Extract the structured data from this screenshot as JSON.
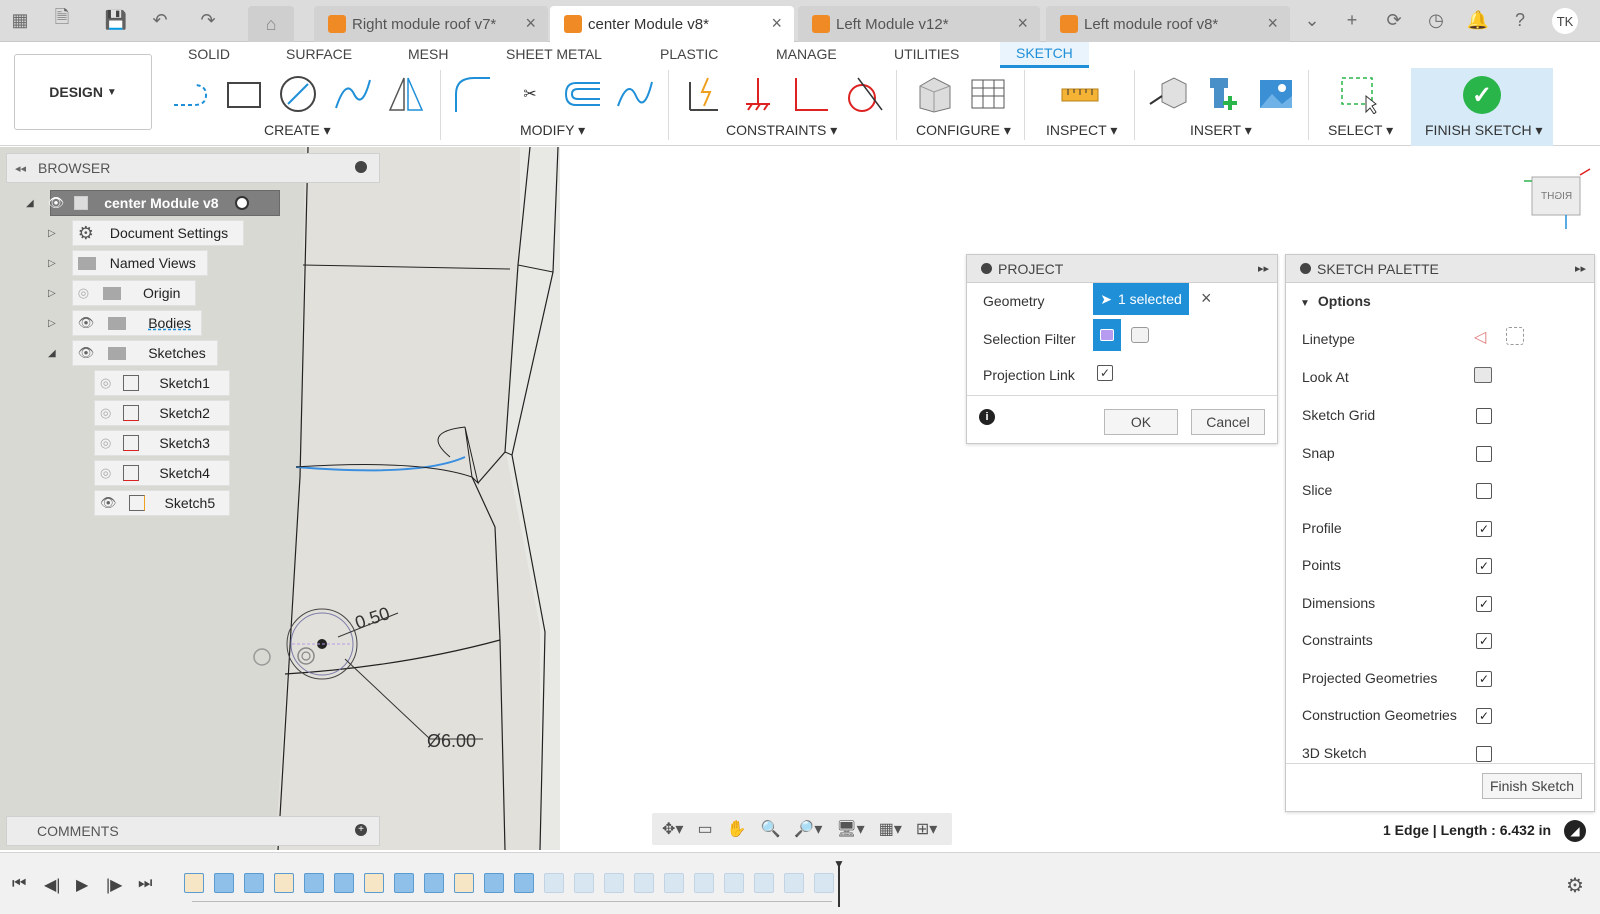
{
  "tabs": [
    {
      "label": "Right module roof v7*",
      "active": false
    },
    {
      "label": "center Module v8*",
      "active": true
    },
    {
      "label": "Left Module v12*",
      "active": false
    },
    {
      "label": "Left module roof v8*",
      "active": false
    }
  ],
  "user": {
    "initials": "TK"
  },
  "workspace": {
    "label": "DESIGN"
  },
  "ribbon_tabs": [
    "SOLID",
    "SURFACE",
    "MESH",
    "SHEET METAL",
    "PLASTIC",
    "MANAGE",
    "UTILITIES",
    "SKETCH"
  ],
  "ribbon_groups": {
    "create": "CREATE",
    "modify": "MODIFY",
    "constraints": "CONSTRAINTS",
    "configure": "CONFIGURE",
    "inspect": "INSPECT",
    "insert": "INSERT",
    "select": "SELECT",
    "finish": "FINISH SKETCH"
  },
  "browser": {
    "title": "BROWSER",
    "root": "center Module v8",
    "items": [
      "Document Settings",
      "Named Views",
      "Origin",
      "Bodies",
      "Sketches"
    ],
    "sketches": [
      "Sketch1",
      "Sketch2",
      "Sketch3",
      "Sketch4",
      "Sketch5"
    ]
  },
  "comments": {
    "title": "COMMENTS"
  },
  "canvas": {
    "dim1": "0.50",
    "dim2": "Ø6.00",
    "viewcube": "RIGHT"
  },
  "project": {
    "title": "PROJECT",
    "geometry_label": "Geometry",
    "geometry_value": "1 selected",
    "filter_label": "Selection Filter",
    "link_label": "Projection Link",
    "link_checked": true,
    "ok": "OK",
    "cancel": "Cancel"
  },
  "palette": {
    "title": "SKETCH PALETTE",
    "section": "Options",
    "linetype": "Linetype",
    "lookat": "Look At",
    "options": [
      {
        "label": "Sketch Grid",
        "checked": false
      },
      {
        "label": "Snap",
        "checked": false
      },
      {
        "label": "Slice",
        "checked": false
      },
      {
        "label": "Profile",
        "checked": true
      },
      {
        "label": "Points",
        "checked": true
      },
      {
        "label": "Dimensions",
        "checked": true
      },
      {
        "label": "Constraints",
        "checked": true
      },
      {
        "label": "Projected Geometries",
        "checked": true
      },
      {
        "label": "Construction Geometries",
        "checked": true
      },
      {
        "label": "3D Sketch",
        "checked": false
      }
    ],
    "finish": "Finish Sketch"
  },
  "status": {
    "text": "1 Edge | Length : 6.432 in"
  },
  "colors": {
    "accent": "#1f8fd8",
    "finish_check": "#2ab54a",
    "tab_cube": "#f08a24"
  }
}
